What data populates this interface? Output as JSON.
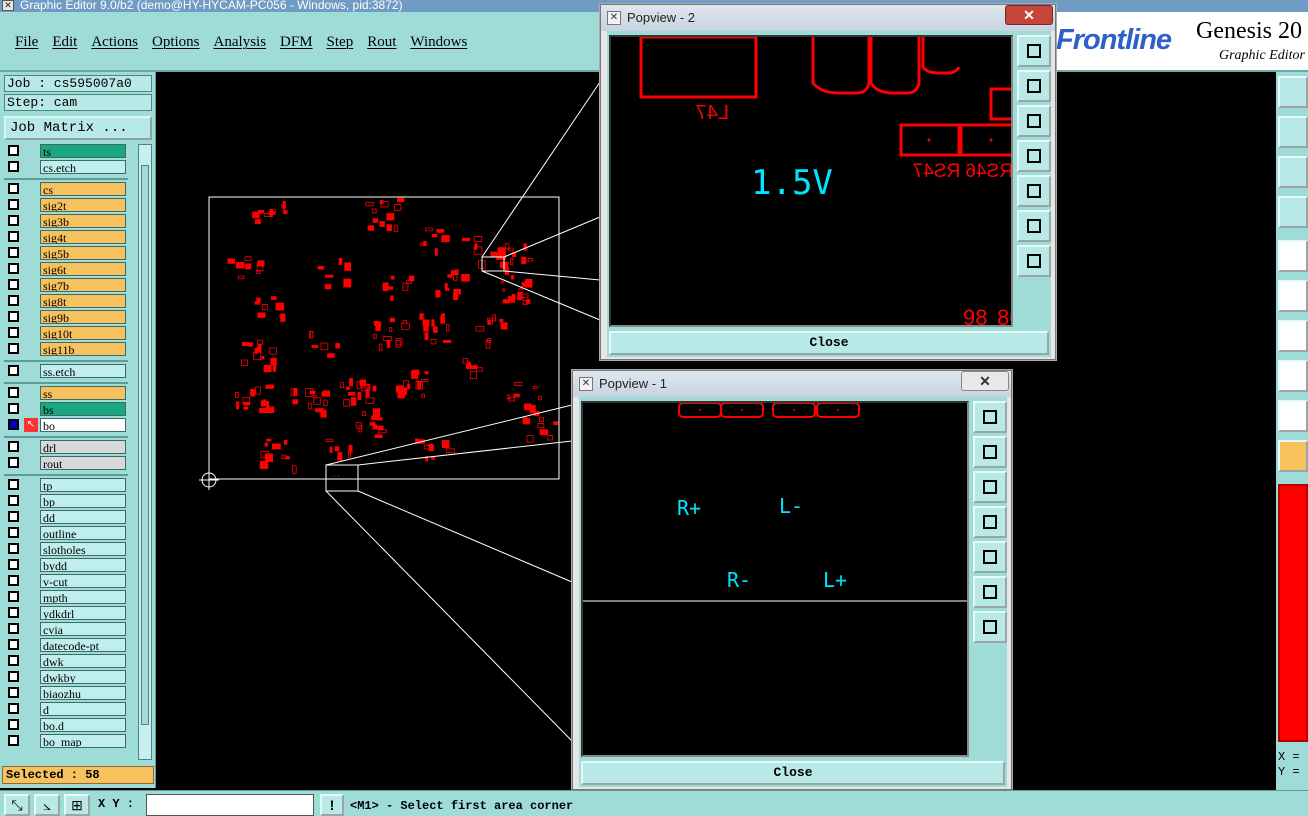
{
  "window": {
    "title": "Graphic Editor 9.0/b2 (demo@HY-HYCAM-PC056 - Windows, pid:3872)"
  },
  "menu": [
    "File",
    "Edit",
    "Actions",
    "Options",
    "Analysis",
    "DFM",
    "Step",
    "Rout",
    "Windows"
  ],
  "brand": {
    "logo": "Frontline",
    "product": "Genesis 20",
    "subtitle": "Graphic Editor"
  },
  "job": {
    "label": "Job : cs595007a0",
    "step": "Step: cam",
    "matrix_button": "Job Matrix ..."
  },
  "layers": [
    {
      "name": "ts",
      "color": "green"
    },
    {
      "name": "cs.etch",
      "color": "blue"
    },
    {
      "name": "cs",
      "color": "yellow"
    },
    {
      "name": "sig2t",
      "color": "yellow"
    },
    {
      "name": "sig3b",
      "color": "yellow"
    },
    {
      "name": "sig4t",
      "color": "yellow"
    },
    {
      "name": "sig5b",
      "color": "yellow"
    },
    {
      "name": "sig6t",
      "color": "yellow"
    },
    {
      "name": "sig7b",
      "color": "yellow"
    },
    {
      "name": "sig8t",
      "color": "yellow"
    },
    {
      "name": "sig9b",
      "color": "yellow"
    },
    {
      "name": "sig10t",
      "color": "yellow"
    },
    {
      "name": "sig11b",
      "color": "yellow"
    },
    {
      "name": "ss.etch",
      "color": "blue"
    },
    {
      "name": "ss",
      "color": "yellow"
    },
    {
      "name": "bs",
      "color": "green"
    },
    {
      "name": "bo",
      "color": "white",
      "active": true
    },
    {
      "name": "drl",
      "color": "grey"
    },
    {
      "name": "rout",
      "color": "grey"
    },
    {
      "name": "tp",
      "color": "blue"
    },
    {
      "name": "bp",
      "color": "blue"
    },
    {
      "name": "dd",
      "color": "blue"
    },
    {
      "name": "outline",
      "color": "blue"
    },
    {
      "name": "slotholes",
      "color": "blue"
    },
    {
      "name": "bydd",
      "color": "blue"
    },
    {
      "name": "v-cut",
      "color": "blue"
    },
    {
      "name": "mpth",
      "color": "blue"
    },
    {
      "name": "ydkdrl",
      "color": "blue"
    },
    {
      "name": "cvia",
      "color": "blue"
    },
    {
      "name": "datecode-pt",
      "color": "blue"
    },
    {
      "name": "dwk",
      "color": "blue"
    },
    {
      "name": "dwkby",
      "color": "blue"
    },
    {
      "name": "biaozhu",
      "color": "blue"
    },
    {
      "name": "d",
      "color": "blue"
    },
    {
      "name": "bo.d",
      "color": "blue"
    },
    {
      "name": "bo_map",
      "color": "blue"
    }
  ],
  "selected": "Selected : 58",
  "status": {
    "xy_label": "X Y :",
    "xy_value": "",
    "prompt": "<M1> - Select first area corner"
  },
  "popview2": {
    "title": "Popview - 2",
    "close": "Close",
    "texts": [
      "1.5V",
      "L47",
      "RS46 RS47",
      "98",
      "86"
    ]
  },
  "popview1": {
    "title": "Popview - 1",
    "close": "Close",
    "texts": [
      "R+",
      "L-",
      "R-",
      "L+"
    ]
  },
  "xy_readout": {
    "x": "X =",
    "y": "Y ="
  },
  "colors": {
    "panel": "#9fdcd8",
    "feature": "#ff0000",
    "text_on_pcb": "#00e5ff",
    "layer_signal": "#f7c25e",
    "layer_mask": "#1aa77e"
  }
}
